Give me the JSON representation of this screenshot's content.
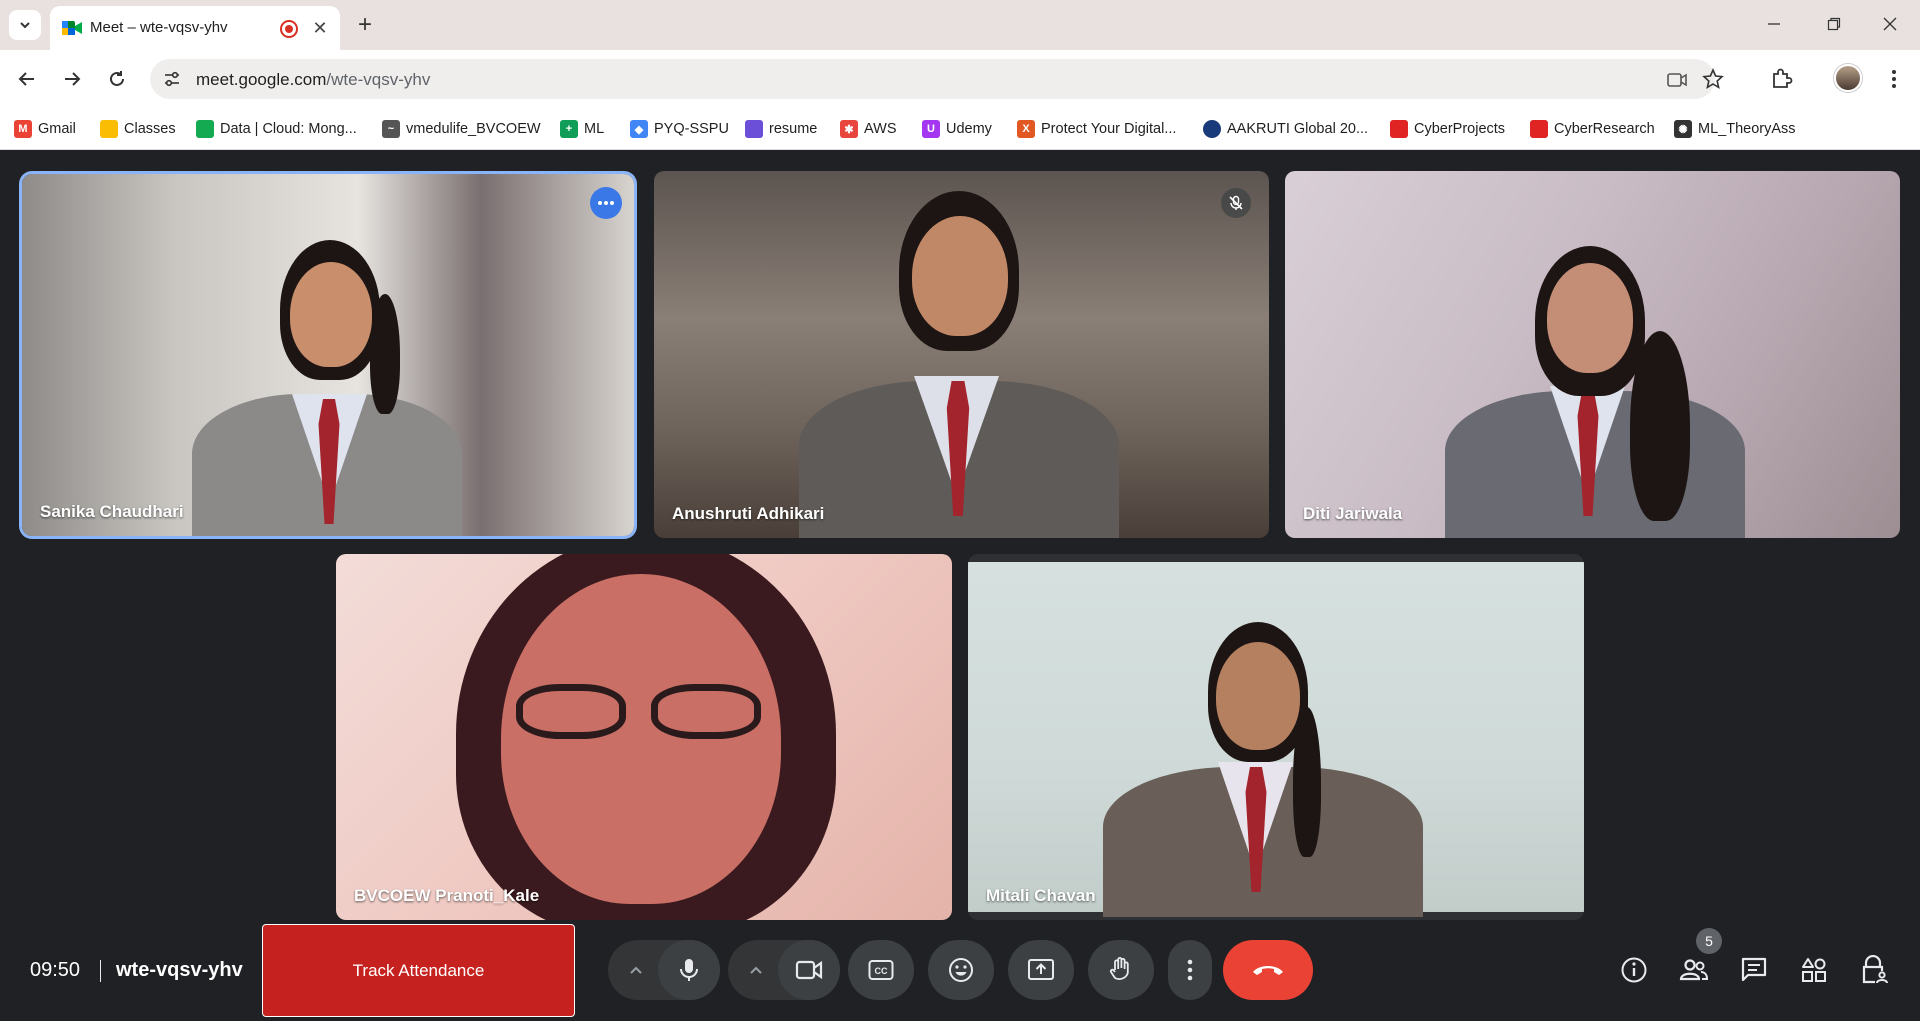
{
  "browser": {
    "tab_title": "Meet – wte-vqsv-yhv",
    "url_host": "meet.google.com",
    "url_path": "/wte-vqsv-yhv"
  },
  "bookmarks": [
    {
      "label": "Gmail",
      "icon": "gmail-icon",
      "color": "#ea4335"
    },
    {
      "label": "Classes",
      "icon": "classroom-icon",
      "color": "#fbbc04"
    },
    {
      "label": "Data | Cloud: Mong...",
      "icon": "mongodb-icon",
      "color": "#13aa52"
    },
    {
      "label": "vmedulife_BVCOEW",
      "icon": "vmedulife-icon",
      "color": "#555555"
    },
    {
      "label": "ML",
      "icon": "sheets-icon",
      "color": "#0f9d58"
    },
    {
      "label": "PYQ-SSPU",
      "icon": "diamond-icon",
      "color": "#4285f4"
    },
    {
      "label": "resume",
      "icon": "resume-icon",
      "color": "#6c4fd8"
    },
    {
      "label": "AWS",
      "icon": "aws-icon",
      "color": "#e8453c"
    },
    {
      "label": "Udemy",
      "icon": "udemy-icon",
      "color": "#a435f0"
    },
    {
      "label": "Protect Your Digital...",
      "icon": "x-logo-icon",
      "color": "#e25822"
    },
    {
      "label": "AAKRUTI Global 20...",
      "icon": "globe-icon",
      "color": "#1a3b7a"
    },
    {
      "label": "CyberProjects",
      "icon": "bookmark-red-icon",
      "color": "#e02424"
    },
    {
      "label": "CyberResearch",
      "icon": "bookmark-red-icon",
      "color": "#e02424"
    },
    {
      "label": "ML_TheoryAss",
      "icon": "openai-icon",
      "color": "#333333"
    }
  ],
  "participants": [
    {
      "name": "Sanika Chaudhari"
    },
    {
      "name": "Anushruti Adhikari"
    },
    {
      "name": "Diti Jariwala"
    },
    {
      "name": "BVCOEW Pranoti_Kale"
    },
    {
      "name": "Mitali Chavan"
    }
  ],
  "meeting": {
    "time": "09:50",
    "code": "wte-vqsv-yhv",
    "track_attendance_label": "Track Attendance",
    "people_count": "5"
  },
  "colors": {
    "end_call": "#ea4335",
    "track_attendance": "#c5221f",
    "speaking_highlight": "#8ab4f8"
  }
}
